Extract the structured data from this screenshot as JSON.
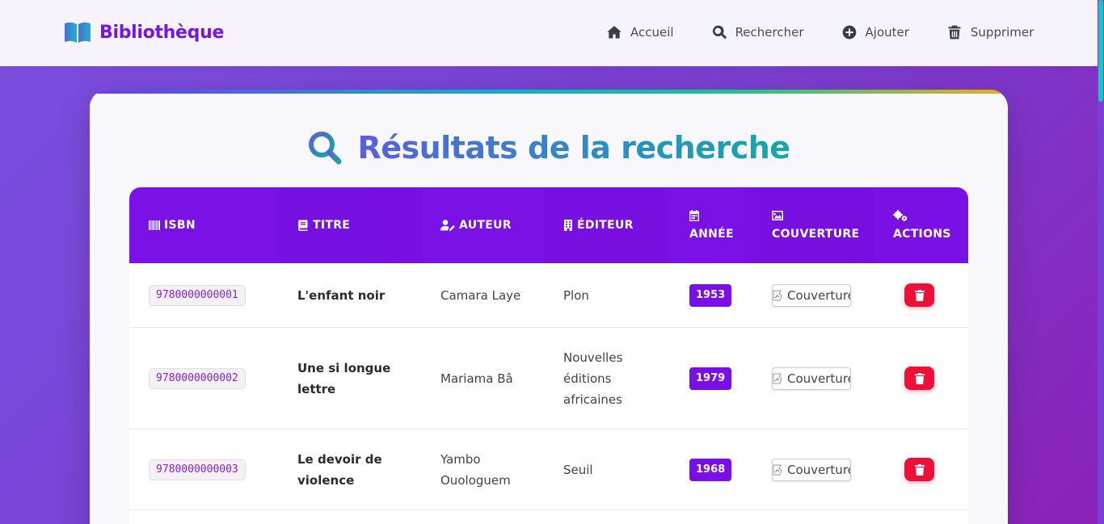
{
  "brand": {
    "name": "Bibliothèque"
  },
  "nav": {
    "items": [
      {
        "label": "Accueil",
        "icon": "home-icon"
      },
      {
        "label": "Rechercher",
        "icon": "search-icon"
      },
      {
        "label": "Ajouter",
        "icon": "plus-circle-icon"
      },
      {
        "label": "Supprimer",
        "icon": "trash-icon"
      }
    ]
  },
  "page": {
    "title": "Résultats de la recherche"
  },
  "table": {
    "headers": [
      {
        "label": "ISBN",
        "icon": "barcode-icon"
      },
      {
        "label": "Titre",
        "icon": "book-icon"
      },
      {
        "label": "Auteur",
        "icon": "user-pen-icon"
      },
      {
        "label": "Éditeur",
        "icon": "building-icon"
      },
      {
        "label": "Année",
        "icon": "calendar-icon"
      },
      {
        "label": "Couverture",
        "icon": "image-icon"
      },
      {
        "label": "Actions",
        "icon": "cogs-icon"
      }
    ],
    "rows": [
      {
        "isbn": "9780000000001",
        "title": "L'enfant noir",
        "author": "Camara Laye",
        "publisher": "Plon",
        "year": "1953",
        "cover_alt": "Couverture"
      },
      {
        "isbn": "9780000000002",
        "title": "Une si longue lettre",
        "author": "Mariama Bâ",
        "publisher": "Nouvelles éditions africaines",
        "year": "1979",
        "cover_alt": "Couverture"
      },
      {
        "isbn": "9780000000003",
        "title": "Le devoir de violence",
        "author": "Yambo Ouologuem",
        "publisher": "Seuil",
        "year": "1968",
        "cover_alt": "Couverture"
      }
    ]
  },
  "colors": {
    "accent": "#7a12e8",
    "danger": "#ee1037",
    "brand": "#7a14e6"
  }
}
